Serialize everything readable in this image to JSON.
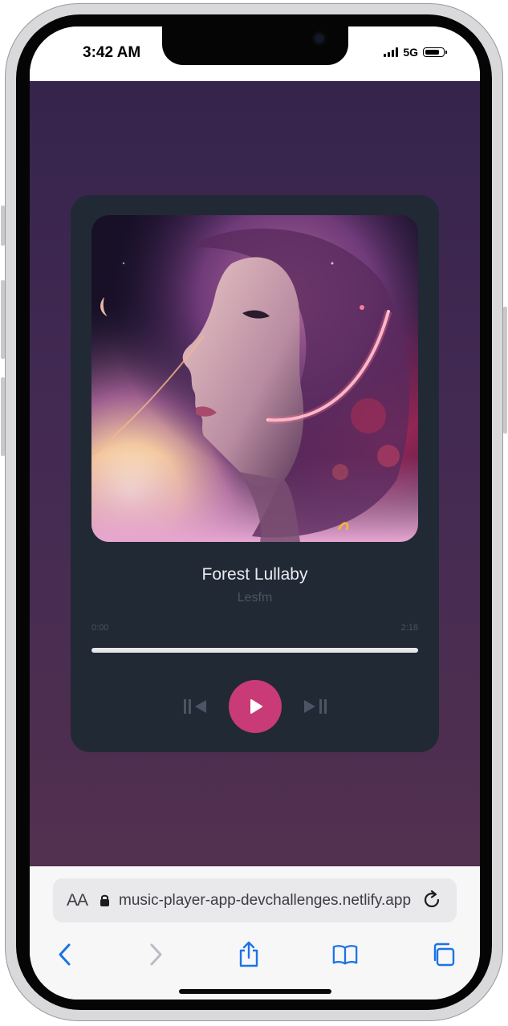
{
  "status_bar": {
    "time": "3:42 AM",
    "network": "5G",
    "battery_level": 0.85
  },
  "player": {
    "title": "Forest Lullaby",
    "artist": "Lesfm",
    "current_time": "0:00",
    "duration": "2:18",
    "progress": 1.0,
    "accent_color": "#c93b76",
    "card_color": "#212935"
  },
  "browser": {
    "text_size_label": "AA",
    "url": "music-player-app-devchallenges.netlify.app"
  },
  "icons": {
    "prev": "skip-back-icon",
    "play": "play-icon",
    "next": "skip-forward-icon",
    "lock": "lock-icon",
    "reload": "reload-icon",
    "back": "chevron-left-icon",
    "forward": "chevron-right-icon",
    "share": "share-icon",
    "bookmarks": "book-icon",
    "tabs": "tabs-icon"
  }
}
